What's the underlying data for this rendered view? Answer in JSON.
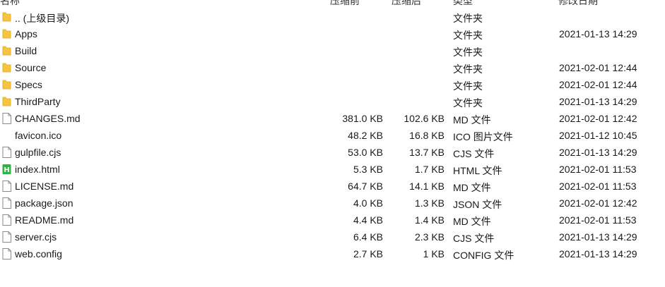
{
  "columns": {
    "name": "名称",
    "size_before": "压缩前",
    "size_after": "压缩后",
    "type": "类型",
    "modified": "修改日期"
  },
  "colors": {
    "folder": "#f5c542",
    "html_icon": "#2fb344",
    "file_outline": "#8a8a8a"
  },
  "rows": [
    {
      "name": ".. (上级目录)",
      "before": "",
      "after": "",
      "type": "文件夹",
      "date": "",
      "icon": "folder-icon"
    },
    {
      "name": "Apps",
      "before": "",
      "after": "",
      "type": "文件夹",
      "date": "2021-01-13 14:29",
      "icon": "folder-icon"
    },
    {
      "name": "Build",
      "before": "",
      "after": "",
      "type": "文件夹",
      "date": "",
      "icon": "folder-icon"
    },
    {
      "name": "Source",
      "before": "",
      "after": "",
      "type": "文件夹",
      "date": "2021-02-01 12:44",
      "icon": "folder-icon"
    },
    {
      "name": "Specs",
      "before": "",
      "after": "",
      "type": "文件夹",
      "date": "2021-02-01 12:44",
      "icon": "folder-icon"
    },
    {
      "name": "ThirdParty",
      "before": "",
      "after": "",
      "type": "文件夹",
      "date": "2021-01-13 14:29",
      "icon": "folder-icon"
    },
    {
      "name": "CHANGES.md",
      "before": "381.0 KB",
      "after": "102.6 KB",
      "type": "MD 文件",
      "date": "2021-02-01 12:42",
      "icon": "file-icon"
    },
    {
      "name": "favicon.ico",
      "before": "48.2 KB",
      "after": "16.8 KB",
      "type": "ICO 图片文件",
      "date": "2021-01-12 10:45",
      "icon": "none"
    },
    {
      "name": "gulpfile.cjs",
      "before": "53.0 KB",
      "after": "13.7 KB",
      "type": "CJS 文件",
      "date": "2021-01-13 14:29",
      "icon": "file-icon"
    },
    {
      "name": "index.html",
      "before": "5.3 KB",
      "after": "1.7 KB",
      "type": "HTML 文件",
      "date": "2021-02-01 11:53",
      "icon": "html-file-icon"
    },
    {
      "name": "LICENSE.md",
      "before": "64.7 KB",
      "after": "14.1 KB",
      "type": "MD 文件",
      "date": "2021-02-01 11:53",
      "icon": "file-icon"
    },
    {
      "name": "package.json",
      "before": "4.0 KB",
      "after": "1.3 KB",
      "type": "JSON 文件",
      "date": "2021-02-01 12:42",
      "icon": "file-icon"
    },
    {
      "name": "README.md",
      "before": "4.4 KB",
      "after": "1.4 KB",
      "type": "MD 文件",
      "date": "2021-02-01 11:53",
      "icon": "file-icon"
    },
    {
      "name": "server.cjs",
      "before": "6.4 KB",
      "after": "2.3 KB",
      "type": "CJS 文件",
      "date": "2021-01-13 14:29",
      "icon": "file-icon"
    },
    {
      "name": "web.config",
      "before": "2.7 KB",
      "after": "1 KB",
      "type": "CONFIG 文件",
      "date": "2021-01-13 14:29",
      "icon": "file-icon"
    }
  ]
}
